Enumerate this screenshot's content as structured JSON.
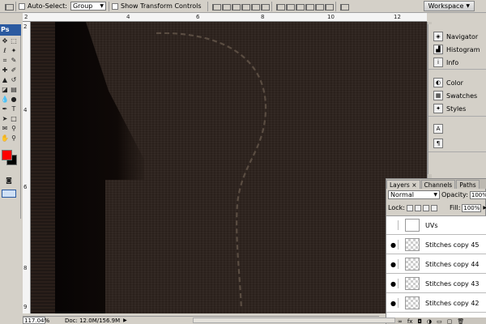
{
  "options_bar": {
    "auto_select_label": "Auto-Select:",
    "auto_select_value": "Group",
    "show_transform_label": "Show Transform Controls",
    "workspace_label": "Workspace"
  },
  "tools_panel": {
    "header": "Ps",
    "foreground_color": "#ff0000",
    "background_color": "#000000"
  },
  "ruler_top": [
    "2",
    "4",
    "6",
    "8",
    "10",
    "12"
  ],
  "ruler_left": [
    "2",
    "4",
    "6",
    "8",
    "9"
  ],
  "dock": {
    "group1": [
      "Navigator",
      "Histogram",
      "Info"
    ],
    "group2": [
      "Color",
      "Swatches",
      "Styles"
    ]
  },
  "layers_panel": {
    "tabs": [
      "Layers",
      "Channels",
      "Paths"
    ],
    "blend_mode": "Normal",
    "opacity_label": "Opacity:",
    "opacity_value": "100%",
    "lock_label": "Lock:",
    "fill_label": "Fill:",
    "fill_value": "100%",
    "layers": [
      {
        "name": "UVs",
        "visible": false
      },
      {
        "name": "Stitches copy 45",
        "visible": true
      },
      {
        "name": "Stitches copy 44",
        "visible": true
      },
      {
        "name": "Stitches copy 43",
        "visible": true
      },
      {
        "name": "Stitches copy 42",
        "visible": true
      }
    ]
  },
  "status_bar": {
    "zoom": "117.04%",
    "doc_info": "Doc: 12.0M/156.9M"
  },
  "colors": {
    "canvas_bg": "#2b211c",
    "stitch": "#5a4d42",
    "panel_bg": "#d4d0c8",
    "header_blue": "#2b5aa0"
  }
}
